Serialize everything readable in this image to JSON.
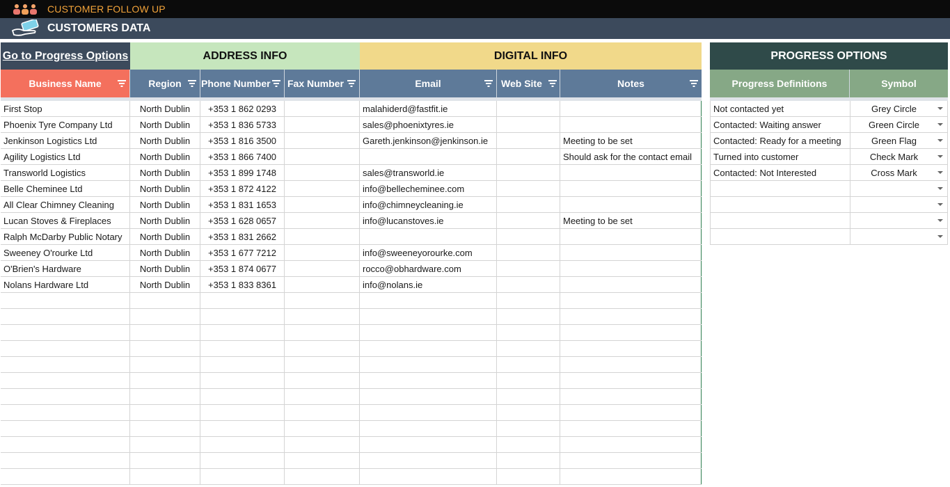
{
  "header": {
    "app_title": "CUSTOMER FOLLOW UP",
    "sheet_title": "CUSTOMERS DATA",
    "icons": [
      "people-icon",
      "hand-card-icon"
    ],
    "colors": {
      "top_bar": "#0b0b0b",
      "title_accent": "#f2a33a",
      "sub_bar": "#3c4a5c"
    }
  },
  "main": {
    "go_link": "Go to Progress Options",
    "address_info": "ADDRESS INFO",
    "digital_info": "DIGITAL INFO",
    "columns": [
      "Business Name",
      "Region",
      "Phone Number",
      "Fax Number",
      "Email",
      "Web Site",
      "Notes"
    ],
    "rows": [
      [
        "First Stop",
        "North Dublin",
        "+353 1 862 0293",
        "",
        "malahiderd@fastfit.ie",
        "",
        ""
      ],
      [
        "Phoenix Tyre Company Ltd",
        "North Dublin",
        "+353 1 836 5733",
        "",
        "sales@phoenixtyres.ie",
        "",
        ""
      ],
      [
        "Jenkinson Logistics Ltd",
        "North Dublin",
        "+353 1 816 3500",
        "",
        "Gareth.jenkinson@jenkinson.ie",
        "",
        "Meeting to be set"
      ],
      [
        "Agility Logistics Ltd",
        "North Dublin",
        "+353 1 866 7400",
        "",
        "",
        "",
        "Should ask for the contact email"
      ],
      [
        "Transworld Logistics",
        "North Dublin",
        "+353 1 899 1748",
        "",
        "sales@transworld.ie",
        "",
        ""
      ],
      [
        "Belle Cheminee Ltd",
        "North Dublin",
        "+353 1 872 4122",
        "",
        "info@bellecheminee.com",
        "",
        ""
      ],
      [
        "All Clear Chimney Cleaning",
        "North Dublin",
        "+353 1 831 1653",
        "",
        "info@chimneycleaning.ie",
        "",
        ""
      ],
      [
        "Lucan Stoves & Fireplaces",
        "North Dublin",
        "+353 1 628 0657",
        "",
        "info@lucanstoves.ie",
        "",
        "Meeting to be set"
      ],
      [
        "Ralph McDarby Public Notary",
        "North Dublin",
        "+353 1 831 2662",
        "",
        "",
        "",
        ""
      ],
      [
        "Sweeney O'rourke Ltd",
        "North Dublin",
        "+353 1 677 7212",
        "",
        "info@sweeneyorourke.com",
        "",
        ""
      ],
      [
        "O'Brien's Hardware",
        "North Dublin",
        "+353 1 874 0677",
        "",
        "rocco@obhardware.com",
        "",
        ""
      ],
      [
        "Nolans Hardware Ltd",
        "North Dublin",
        "+353 1 833 8361",
        "",
        "info@nolans.ie",
        "",
        ""
      ]
    ],
    "empty_row_count": 12,
    "colors": {
      "business_header": "#f4705d",
      "column_header": "#5e7a99",
      "address_band": "#c6e6bd",
      "digital_band": "#f1d98a"
    }
  },
  "progress": {
    "title": "PROGRESS OPTIONS",
    "columns": [
      "Progress Definitions",
      "Symbol"
    ],
    "rows": [
      [
        "Not contacted yet",
        "Grey Circle"
      ],
      [
        "Contacted: Waiting answer",
        "Green Circle"
      ],
      [
        "Contacted: Ready for a meeting",
        "Green Flag"
      ],
      [
        "Turned into customer",
        "Check Mark"
      ],
      [
        "Contacted: Not Interested",
        "Cross Mark"
      ],
      [
        "",
        ""
      ],
      [
        "",
        ""
      ],
      [
        "",
        ""
      ],
      [
        "",
        ""
      ]
    ],
    "colors": {
      "title_bg": "#2f4a49",
      "header_bg": "#86a886"
    }
  }
}
